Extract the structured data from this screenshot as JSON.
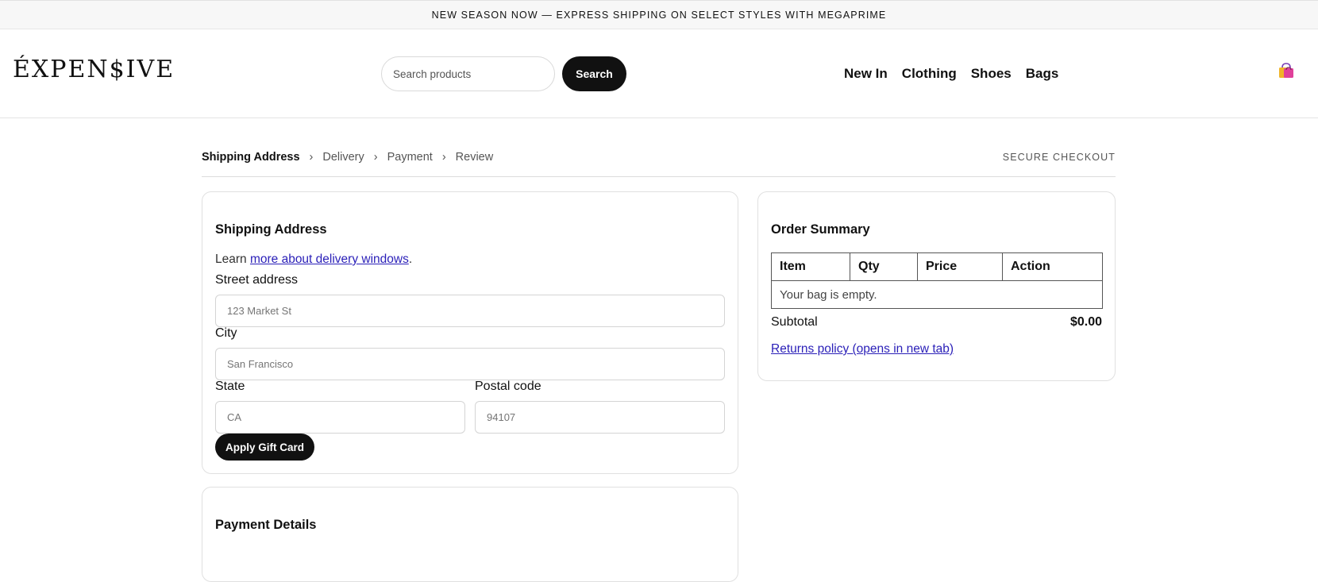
{
  "promo_banner": "NEW SEASON NOW — EXPRESS SHIPPING ON SELECT STYLES WITH MEGAPRIME",
  "header": {
    "logo": "ÉXPEN$IVE",
    "search": {
      "placeholder": "Search products",
      "button_label": "Search"
    },
    "nav": [
      "New In",
      "Clothing",
      "Shoes",
      "Bags"
    ],
    "cart_icon": "shopping-bag-icon"
  },
  "checkout_steps": {
    "steps": [
      "Shipping Address",
      "Delivery",
      "Payment",
      "Review"
    ],
    "active": "Shipping Address",
    "separator": "›",
    "secure_label": "SECURE CHECKOUT"
  },
  "shipping": {
    "title": "Shipping Address",
    "learn_prefix": "Learn ",
    "learn_link": "more about delivery windows",
    "learn_suffix": ".",
    "fields": {
      "street": {
        "label": "Street address",
        "placeholder": "123 Market St"
      },
      "city": {
        "label": "City",
        "placeholder": "San Francisco"
      },
      "state": {
        "label": "State",
        "placeholder": "CA"
      },
      "postal": {
        "label": "Postal code",
        "placeholder": "94107"
      }
    },
    "gift_button": "Apply Gift Card"
  },
  "payment": {
    "title": "Payment Details"
  },
  "summary": {
    "title": "Order Summary",
    "columns": [
      "Item",
      "Qty",
      "Price",
      "Action"
    ],
    "empty_text": "Your bag is empty.",
    "subtotal_label": "Subtotal",
    "subtotal_value": "$0.00",
    "returns_link": "Returns policy (opens in new tab)"
  },
  "colors": {
    "accent": "#111111",
    "link": "#2a1fb8",
    "promo_bg": "#f7f7f7"
  }
}
